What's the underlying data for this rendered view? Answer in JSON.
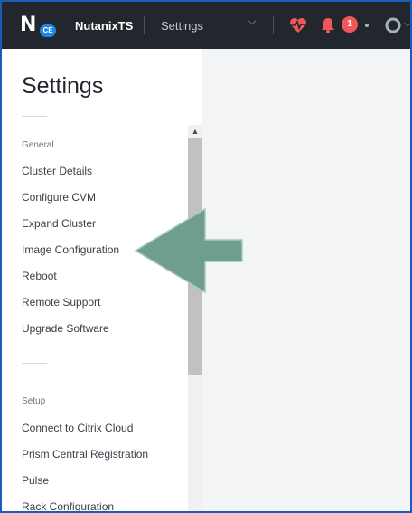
{
  "topbar": {
    "logo_letter": "N",
    "logo_badge": "CE",
    "cluster_name": "NutanixTS",
    "page_menu": "Settings",
    "alerts_count": "1"
  },
  "panel": {
    "title": "Settings",
    "sections": [
      {
        "title": "General",
        "items": [
          "Cluster Details",
          "Configure CVM",
          "Expand Cluster",
          "Image Configuration",
          "Reboot",
          "Remote Support",
          "Upgrade Software"
        ]
      },
      {
        "title": "Setup",
        "items": [
          "Connect to Citrix Cloud",
          "Prism Central Registration",
          "Pulse",
          "Rack Configuration"
        ]
      }
    ]
  },
  "colors": {
    "topbar": "#22272e",
    "accent_red": "#f0575a",
    "annotation_arrow": "#6f9f8c",
    "outer_border": "#1a5cb8"
  },
  "icons": [
    "health-heart-icon",
    "bell-icon",
    "user-icon",
    "chevron-down-icon",
    "scroll-up-arrow-icon"
  ]
}
